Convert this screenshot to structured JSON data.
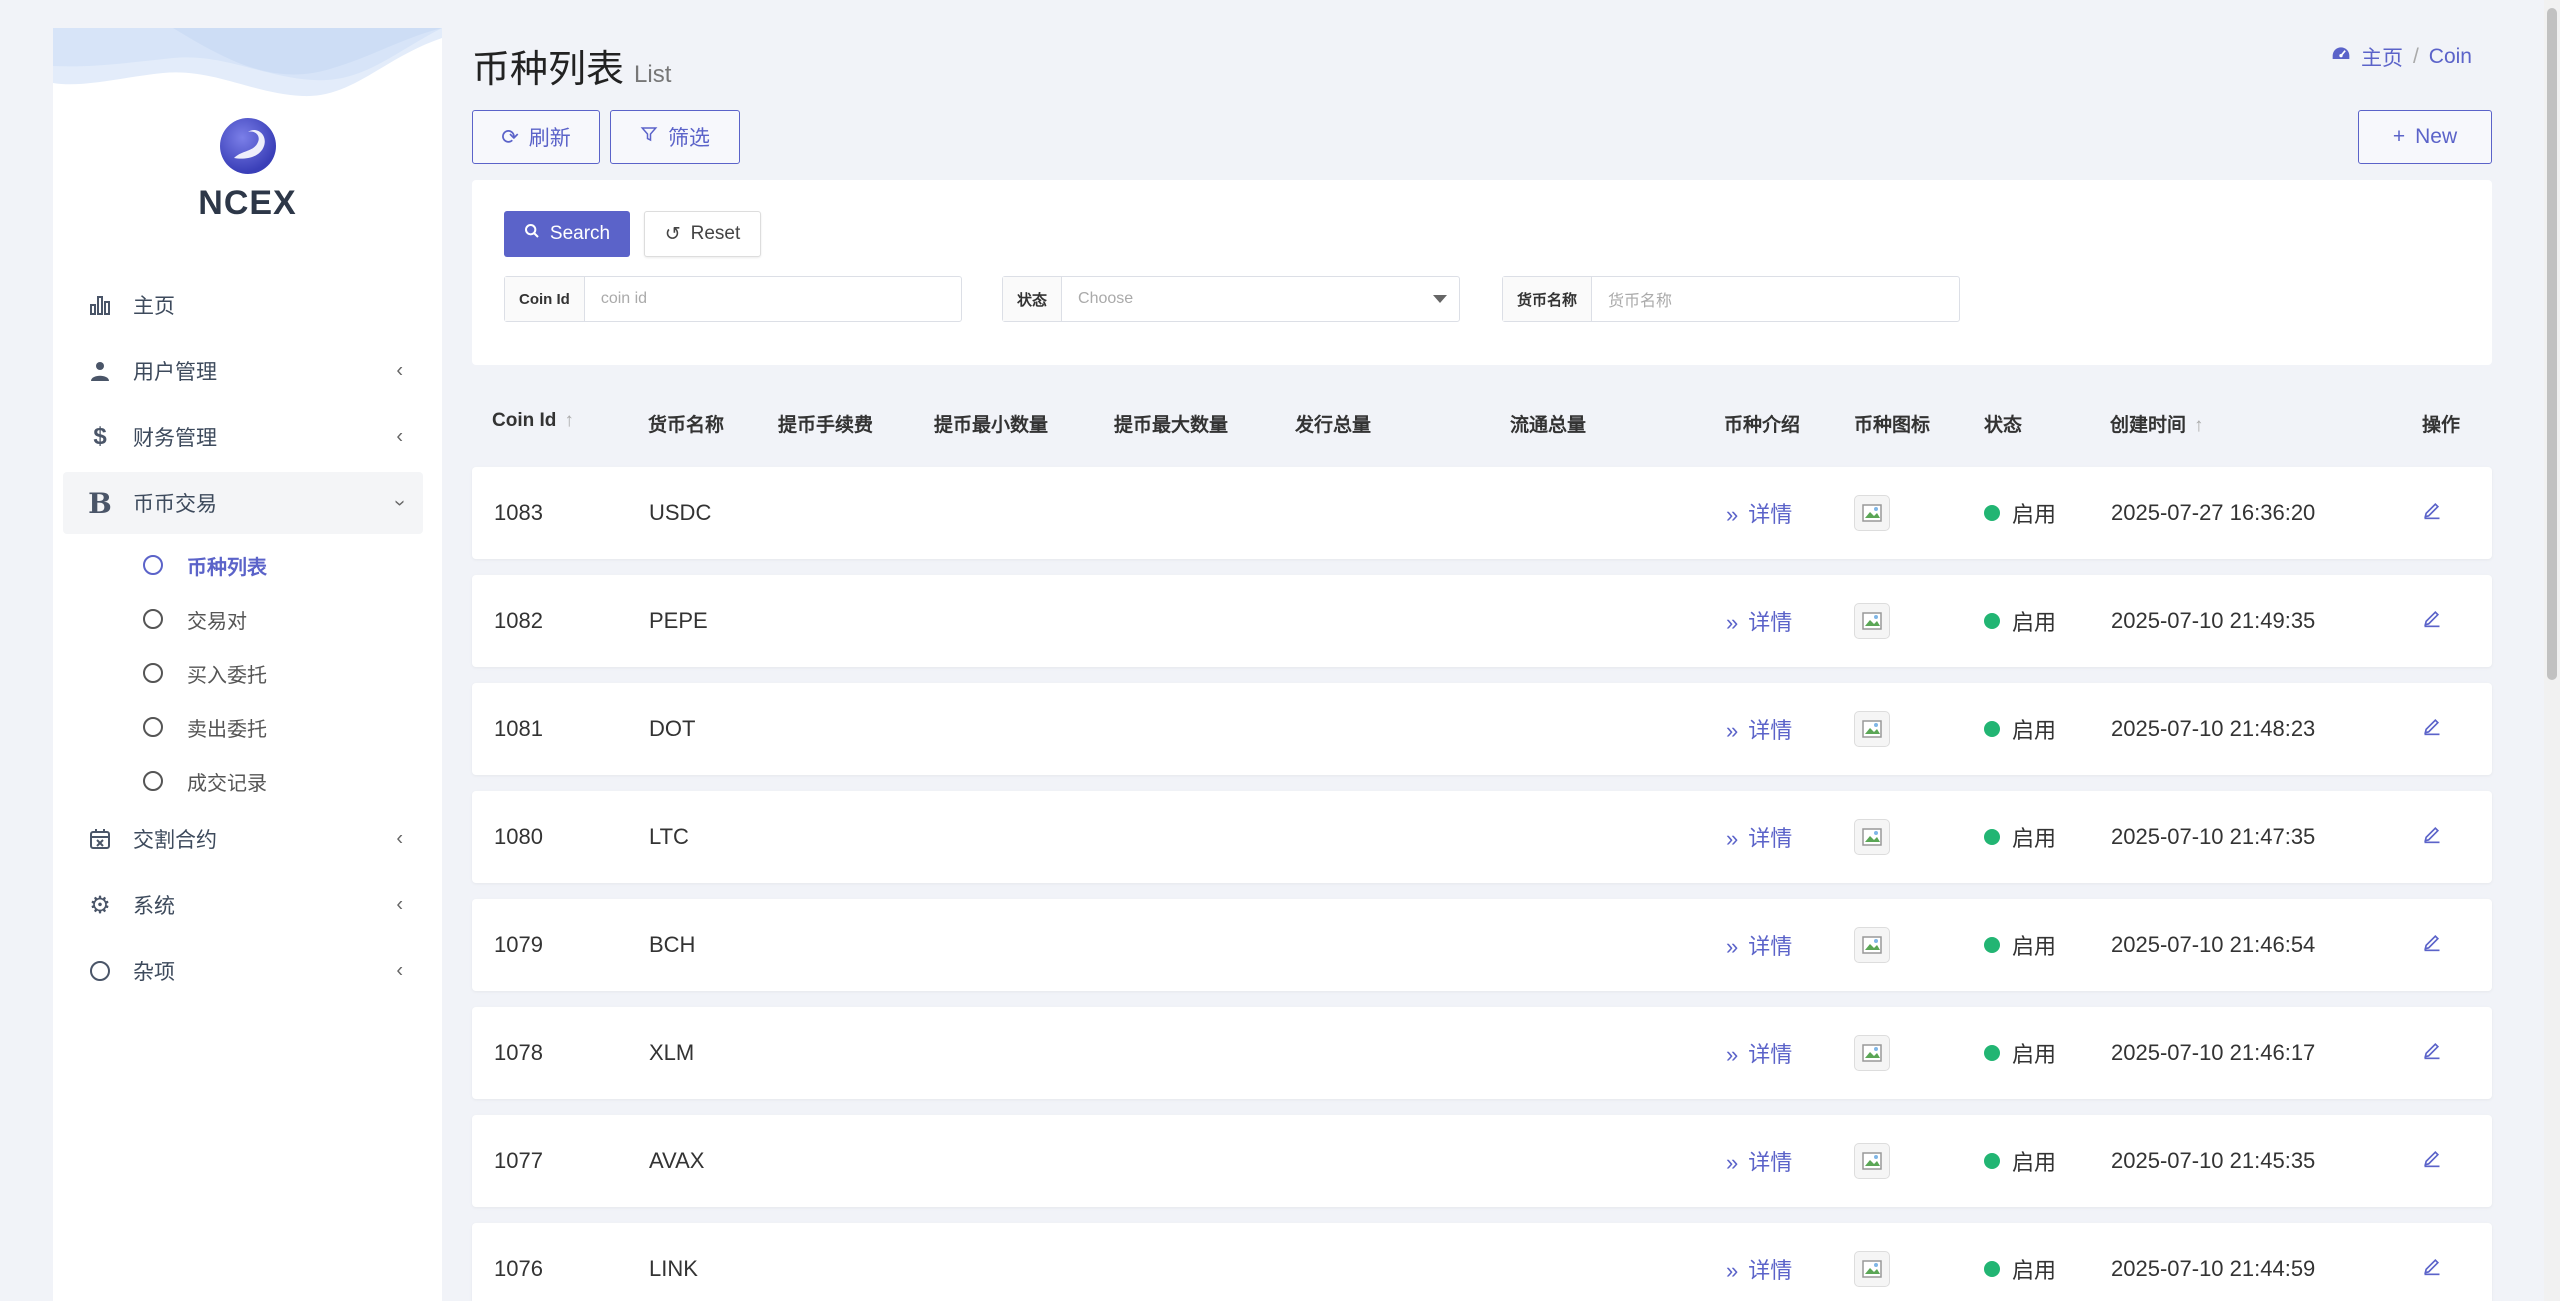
{
  "brand": {
    "name": "NCEX"
  },
  "sidebar": {
    "items": [
      {
        "label": "主页",
        "icon": "bar-chart-icon",
        "has_children": false
      },
      {
        "label": "用户管理",
        "icon": "user-icon",
        "has_children": true
      },
      {
        "label": "财务管理",
        "icon": "dollar-icon",
        "has_children": true
      },
      {
        "label": "币币交易",
        "icon": "bitcoin-icon",
        "has_children": true,
        "expanded": true,
        "children": [
          {
            "label": "币种列表",
            "current": true
          },
          {
            "label": "交易对"
          },
          {
            "label": "买入委托"
          },
          {
            "label": "卖出委托"
          },
          {
            "label": "成交记录"
          }
        ]
      },
      {
        "label": "交割合约",
        "icon": "calendar-x-icon",
        "has_children": true
      },
      {
        "label": "系统",
        "icon": "gear-icon",
        "has_children": true
      },
      {
        "label": "杂项",
        "icon": "circle-icon",
        "has_children": true
      }
    ]
  },
  "header": {
    "title": "币种列表",
    "subtitle": "List",
    "breadcrumb": {
      "home": "主页",
      "separator": "/",
      "current": "Coin"
    }
  },
  "toolbar": {
    "refresh_label": "刷新",
    "filter_label": "筛选",
    "new_label": "New"
  },
  "filter": {
    "search_label": "Search",
    "reset_label": "Reset",
    "fields": {
      "coin_id": {
        "label": "Coin Id",
        "placeholder": "coin id"
      },
      "status": {
        "label": "状态",
        "placeholder": "Choose"
      },
      "coin_name": {
        "label": "货币名称",
        "placeholder": "货币名称"
      }
    }
  },
  "table": {
    "columns": {
      "coin_id": "Coin Id",
      "name": "货币名称",
      "fee": "提币手续费",
      "min_qty": "提币最小数量",
      "max_qty": "提币最大数量",
      "total_issue": "发行总量",
      "circulation": "流通总量",
      "intro": "币种介绍",
      "icon": "币种图标",
      "status": "状态",
      "created_at": "创建时间",
      "actions": "操作"
    },
    "sort_arrow": "↑",
    "detail_label": "详情",
    "status_enabled": "启用",
    "status_color": "#22b573",
    "accent_color": "#5b63c9",
    "rows": [
      {
        "id": "1083",
        "name": "USDC",
        "created_at": "2025-07-27 16:36:20"
      },
      {
        "id": "1082",
        "name": "PEPE",
        "created_at": "2025-07-10 21:49:35"
      },
      {
        "id": "1081",
        "name": "DOT",
        "created_at": "2025-07-10 21:48:23"
      },
      {
        "id": "1080",
        "name": "LTC",
        "created_at": "2025-07-10 21:47:35"
      },
      {
        "id": "1079",
        "name": "BCH",
        "created_at": "2025-07-10 21:46:54"
      },
      {
        "id": "1078",
        "name": "XLM",
        "created_at": "2025-07-10 21:46:17"
      },
      {
        "id": "1077",
        "name": "AVAX",
        "created_at": "2025-07-10 21:45:35"
      },
      {
        "id": "1076",
        "name": "LINK",
        "created_at": "2025-07-10 21:44:59"
      }
    ]
  }
}
